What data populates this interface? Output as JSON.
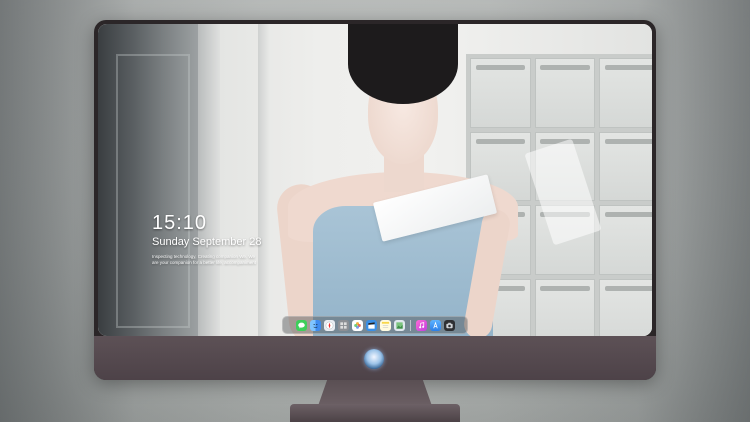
{
  "lock_screen": {
    "time": "15:10",
    "date": "Sunday September 28",
    "tagline": "Inspecting technology, Creating companion We. We are your companion for a better life, accompaniment"
  },
  "dock": {
    "apps": [
      {
        "name": "messages-icon",
        "color": "#3ecf5a"
      },
      {
        "name": "finder-icon",
        "color": "#3f8cf0"
      },
      {
        "name": "safari-icon",
        "color": "#e9edf2"
      },
      {
        "name": "launchpad-icon",
        "color": "#8c8f94"
      },
      {
        "name": "photos-icon",
        "color": "#f2b441"
      },
      {
        "name": "claquette-icon",
        "color": "#3a8fe6"
      },
      {
        "name": "notes-icon",
        "color": "#f7d64a"
      },
      {
        "name": "preview-icon",
        "color": "#7bc37e"
      },
      {
        "name": "music-icon",
        "color": "#e85fd3"
      },
      {
        "name": "app-store-icon",
        "color": "#3f8ff0"
      },
      {
        "name": "camera-icon",
        "color": "#2f3033"
      }
    ]
  }
}
